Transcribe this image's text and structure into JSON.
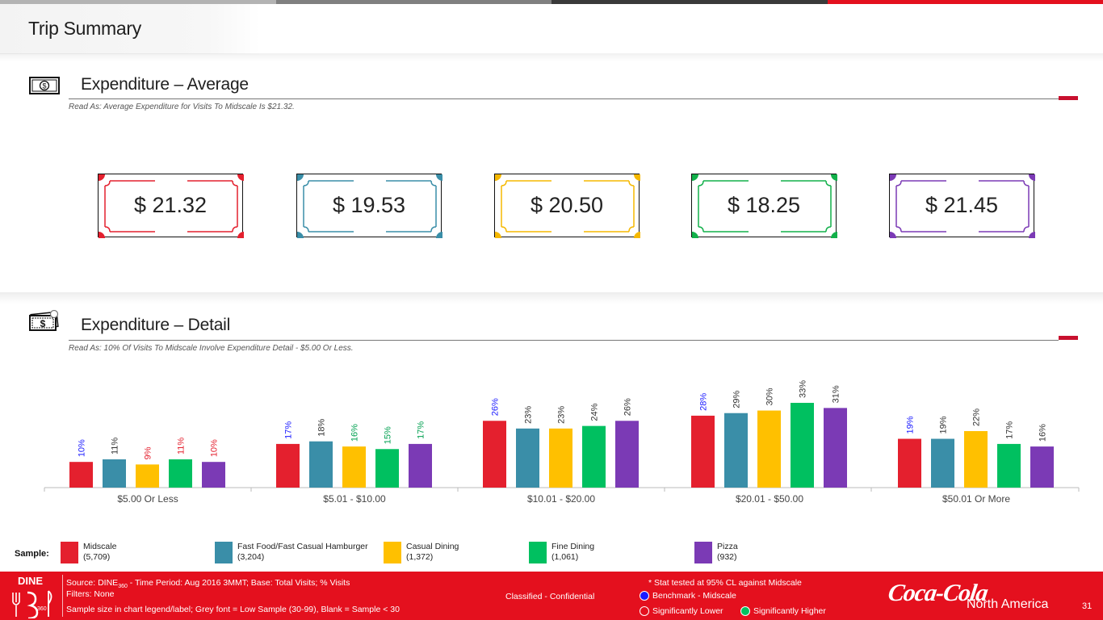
{
  "header": {
    "title": "Trip Summary",
    "topbar_colors": [
      "#b3b3b3",
      "#808080",
      "#3a3a3a",
      "#e4101e"
    ]
  },
  "sections": {
    "average": {
      "title": "Expenditure – Average",
      "read_as": "Read As: Average Expenditure for Visits To Midscale Is $21.32.",
      "icon": "dollar-bill-icon"
    },
    "detail": {
      "title": "Expenditure – Detail",
      "read_as": "Read As: 10% Of Visits To Midscale Involve Expenditure Detail - $5.00 Or Less.",
      "icon": "cash-stack-icon"
    }
  },
  "bills": [
    {
      "value": "$ 21.32",
      "color": "#e4202e"
    },
    {
      "value": "$ 19.53",
      "color": "#3a8ea8"
    },
    {
      "value": "$ 20.50",
      "color": "#f5b800"
    },
    {
      "value": "$ 18.25",
      "color": "#12b04a"
    },
    {
      "value": "$ 21.45",
      "color": "#7b3ab5"
    }
  ],
  "chart_data": {
    "type": "bar",
    "categories": [
      "$5.00 Or Less",
      "$5.01 - $10.00",
      "$10.01 - $20.00",
      "$20.01 - $50.00",
      "$50.01 Or More"
    ],
    "series": [
      {
        "name": "Midscale",
        "color": "#e4202e",
        "values": [
          10,
          17,
          26,
          28,
          19
        ],
        "labels": [
          "10%",
          "17%",
          "26%",
          "28%",
          "19%"
        ]
      },
      {
        "name": "Fast Food/Fast Casual Hamburger",
        "color": "#3a8ea8",
        "values": [
          11,
          18,
          23,
          29,
          19
        ],
        "labels": [
          "11%",
          "18%",
          "23%",
          "29%",
          "19%"
        ]
      },
      {
        "name": "Casual Dining",
        "color": "#ffc000",
        "values": [
          9,
          16,
          23,
          30,
          22
        ],
        "labels": [
          "9%",
          "16%",
          "23%",
          "30%",
          "22%"
        ]
      },
      {
        "name": "Fine Dining",
        "color": "#00c060",
        "values": [
          11,
          15,
          24,
          33,
          17
        ],
        "labels": [
          "11%",
          "15%",
          "24%",
          "33%",
          "17%"
        ]
      },
      {
        "name": "Pizza",
        "color": "#7b3ab5",
        "values": [
          10,
          17,
          26,
          31,
          16
        ],
        "labels": [
          "10%",
          "17%",
          "26%",
          "31%",
          "16%"
        ]
      }
    ],
    "label_colors": [
      [
        "#1a1aff",
        "#333333",
        "#e4202e",
        "#e4202e",
        "#e4202e"
      ],
      [
        "#1a1aff",
        "#333333",
        "#00a050",
        "#00a050",
        "#00a050"
      ],
      [
        "#1a1aff",
        "#333333",
        "#333333",
        "#333333",
        "#333333"
      ],
      [
        "#1a1aff",
        "#333333",
        "#333333",
        "#333333",
        "#333333"
      ],
      [
        "#1a1aff",
        "#333333",
        "#333333",
        "#333333",
        "#333333"
      ]
    ],
    "ylim": [
      0,
      40
    ],
    "grid": false,
    "legend_position": "bottom"
  },
  "legend": {
    "sample_label": "Sample:",
    "items": [
      {
        "name": "Midscale",
        "count": "(5,709)",
        "color": "#e4202e"
      },
      {
        "name": "Fast Food/Fast Casual Hamburger",
        "count": "(3,204)",
        "color": "#3a8ea8"
      },
      {
        "name": "Casual Dining",
        "count": "(1,372)",
        "color": "#ffc000"
      },
      {
        "name": "Fine Dining",
        "count": "(1,061)",
        "color": "#00c060"
      },
      {
        "name": "Pizza",
        "count": "(932)",
        "color": "#7b3ab5"
      }
    ]
  },
  "footer": {
    "logo_top": "DINE",
    "logo_num": "360",
    "source_prefix": "Source: DINE",
    "source_sub": "360",
    "source_rest": " - Time Period: Aug 2016 3MMT; Base: Total Visits; % Visits",
    "filters": "Filters: None",
    "sample_note": "Sample size in chart legend/label;  Grey font = Low Sample (30-99), Blank = Sample < 30",
    "classification": "Classified - Confidential",
    "stat_note": "* Stat tested at 95% CL against Midscale",
    "benchmark": "Benchmark - Midscale",
    "sig_lower": "Significantly Lower",
    "sig_higher": "Significantly Higher",
    "brand": "Coca-Cola",
    "brand_region": "North America",
    "page_number": "31",
    "colors": {
      "footer_bg": "#e4101e",
      "benchmark": "#1a1aff",
      "higher": "#00c060"
    }
  }
}
